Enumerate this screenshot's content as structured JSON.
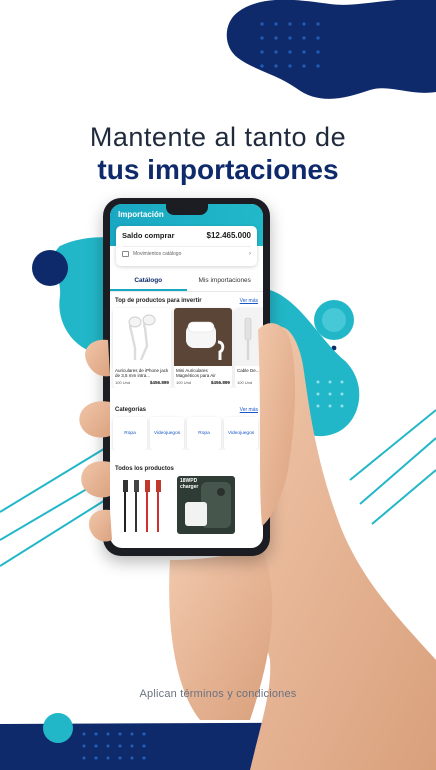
{
  "headline": {
    "line1": "Mantente al tanto de",
    "line2": "tus importaciones"
  },
  "footer_note": "Aplican términos y condiciones",
  "colors": {
    "navy": "#0f2a6b",
    "teal": "#22b7c8",
    "accent_link": "#1a56c9"
  },
  "app": {
    "header_title": "Importación",
    "saldo": {
      "label": "Saldo comprar",
      "value": "$12.465.000",
      "movimientos_label": "Movimientos catálogo",
      "movimientos_icon": "wallet-icon",
      "chevron_icon": "chevron-right-icon"
    },
    "tabs": [
      {
        "label": "Catálogo",
        "active": true
      },
      {
        "label": "Mis importaciones",
        "active": false
      }
    ],
    "top_products": {
      "title": "Top de productos para invertir",
      "link": "Ver más",
      "items": [
        {
          "name": "Auriculares de iPhone jack de 3,5 mm intra...",
          "units": "100 Und",
          "price": "$456.899"
        },
        {
          "name": "Mini Auriculares Magnéticos para Air Pods...",
          "units": "100 Und",
          "price": "$456.899"
        },
        {
          "name": "Cable De... iphone 11...",
          "units": "100 Und",
          "price": ""
        }
      ]
    },
    "categories": {
      "title": "Categorías",
      "link": "Ver más",
      "items": [
        "Ropa",
        "Videojuegos",
        "Ropa",
        "Videojuegos"
      ]
    },
    "all_products": {
      "title": "Todos los productos",
      "charger_label": "18WPD charger"
    }
  }
}
